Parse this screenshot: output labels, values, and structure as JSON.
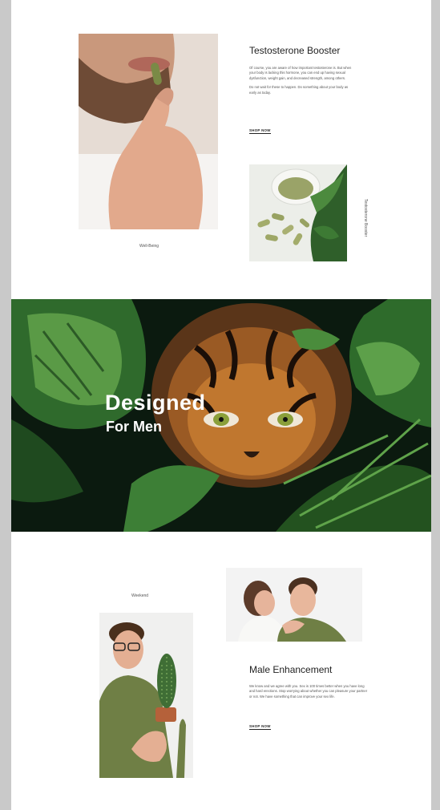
{
  "section_one": {
    "title": "Testosterone Booster",
    "paragraph_one": "Of course, you are aware of how important testosterone is. But when your body is lacking this hormone, you can end up having sexual dysfunction, weight gain, and decreased strength, among others.",
    "paragraph_two": "Do not wait for these to happen. Do something about your body as early as today.",
    "shop_label": "SHOP NOW",
    "image_caption": "Well-Being",
    "vertical_label": "Testosterone Booster"
  },
  "hero": {
    "title": "Designed",
    "subtitle": "For Men"
  },
  "section_two": {
    "image_caption": "Weekend",
    "title": "Male Enhancement",
    "paragraph": "We know and we agree with you. Sex is 100 times better when you have long and hard erections. Stop worrying about whether you can pleasure your partner or not. We have something that can improve your sex life.",
    "shop_label": "SHOP NOW"
  },
  "colors": {
    "page_bg": "#ffffff",
    "outer_bg": "#c9c9c9",
    "jungle_dark": "#0c1a10",
    "leaf_green": "#3f7a3a",
    "tiger_orange": "#b4682a",
    "shirt_olive": "#6f7f45"
  }
}
